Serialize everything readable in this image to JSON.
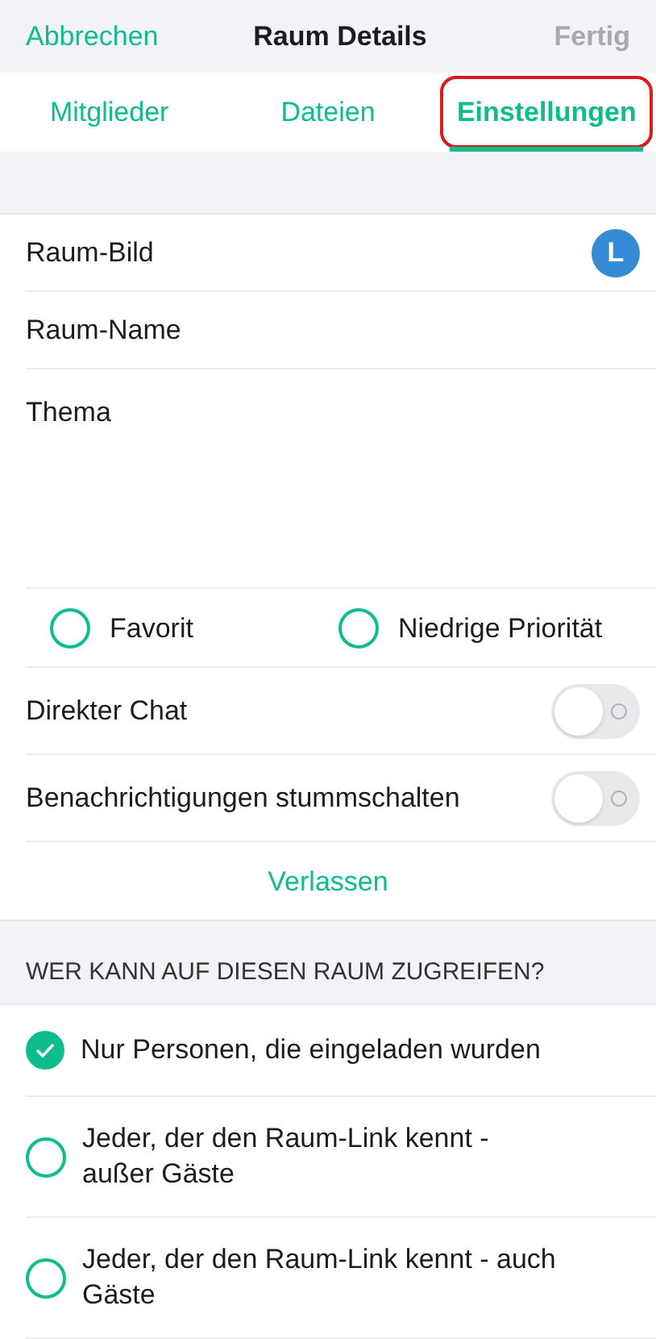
{
  "nav": {
    "cancel": "Abbrechen",
    "title": "Raum Details",
    "done": "Fertig",
    "done_disabled": true
  },
  "tabs": [
    {
      "label": "Mitglieder",
      "selected": false,
      "highlighted": false
    },
    {
      "label": "Dateien",
      "selected": false,
      "highlighted": false
    },
    {
      "label": "Einstellungen",
      "selected": true,
      "highlighted": true
    }
  ],
  "fields": [
    {
      "kind": "avatar",
      "label": "Raum-Bild",
      "avatar": "L"
    },
    {
      "kind": "text",
      "label": "Raum-Name"
    },
    {
      "kind": "textarea",
      "label": "Thema"
    }
  ],
  "tags": [
    {
      "label": "Favorit",
      "selected": false
    },
    {
      "label": "Niedrige Priorität",
      "selected": false
    }
  ],
  "toggles": [
    {
      "label": "Direkter Chat",
      "on": false
    },
    {
      "label": "Benachrichtigungen stummschalten",
      "on": false
    }
  ],
  "leave": "Verlassen",
  "access": {
    "header": "WER KANN AUF DIESEN RAUM ZUGREIFEN?",
    "options": [
      {
        "label": "Nur Personen, die eingeladen wurden",
        "selected": true
      },
      {
        "label": "Jeder, der den Raum-Link kennt - außer Gäste",
        "selected": false
      },
      {
        "label": "Jeder, der den Raum-Link kennt - auch Gäste",
        "selected": false
      }
    ]
  }
}
